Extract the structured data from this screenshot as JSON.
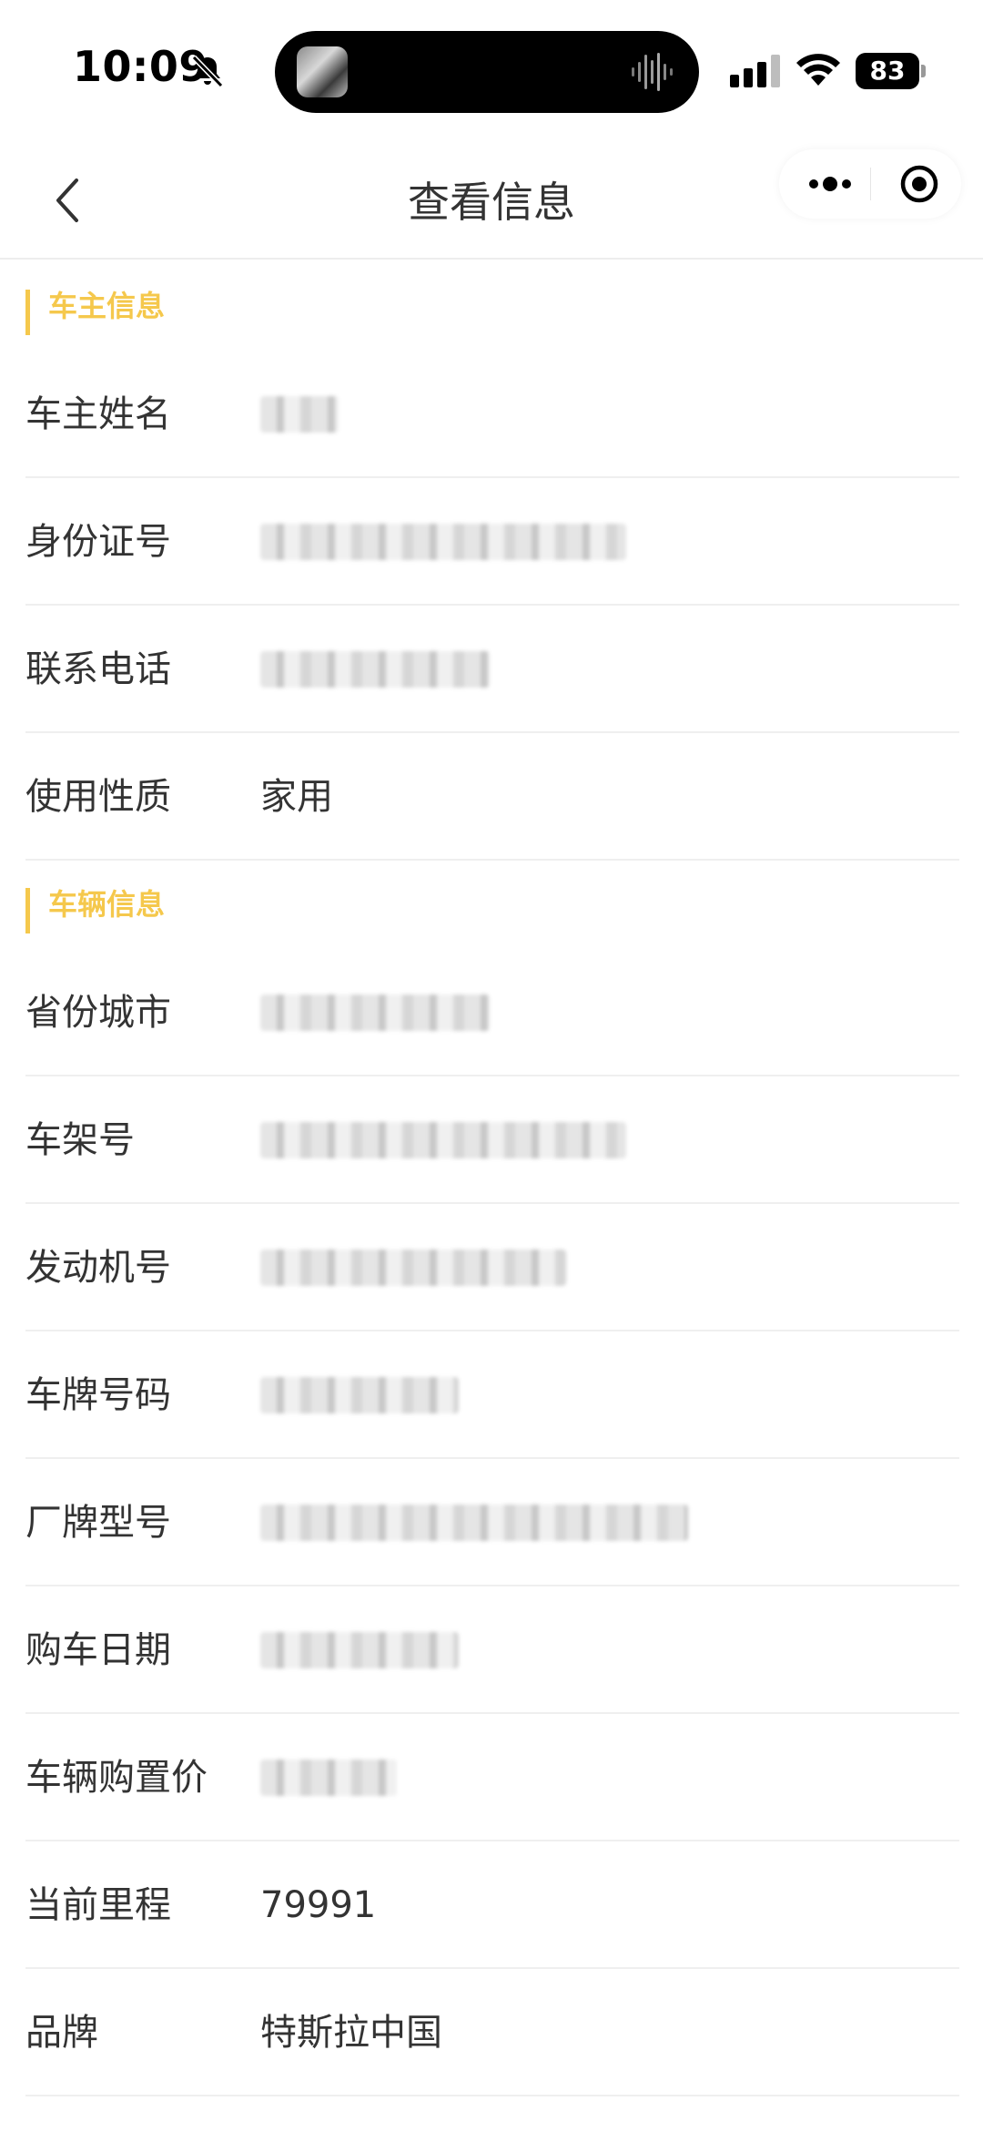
{
  "status_bar": {
    "time": "10:09",
    "battery": "83",
    "icons": [
      "bell-slash-icon",
      "audio-wave-icon",
      "cellular-signal-icon",
      "wifi-icon",
      "battery-icon"
    ]
  },
  "nav": {
    "title": "查看信息",
    "icons": [
      "chevron-left-icon",
      "more-dots-icon",
      "target-close-icon"
    ]
  },
  "owner_section": {
    "title": "车主信息",
    "rows": [
      {
        "label": "车主姓名",
        "value": null
      },
      {
        "label": "身份证号",
        "value": null
      },
      {
        "label": "联系电话",
        "value": null
      },
      {
        "label": "使用性质",
        "value": "家用"
      }
    ]
  },
  "vehicle_section": {
    "title": "车辆信息",
    "rows": [
      {
        "label": "省份城市",
        "value": null
      },
      {
        "label": "车架号",
        "value": null
      },
      {
        "label": "发动机号",
        "value": null
      },
      {
        "label": "车牌号码",
        "value": null
      },
      {
        "label": "厂牌型号",
        "value": null
      },
      {
        "label": "购车日期",
        "value": null
      },
      {
        "label": "车辆购置价",
        "value": null
      },
      {
        "label": "当前里程",
        "value": "79991"
      },
      {
        "label": "品牌",
        "value": "特斯拉中国"
      }
    ]
  },
  "colors": {
    "accent": "#f5c84c",
    "text": "#333333",
    "divider": "#efefef"
  }
}
